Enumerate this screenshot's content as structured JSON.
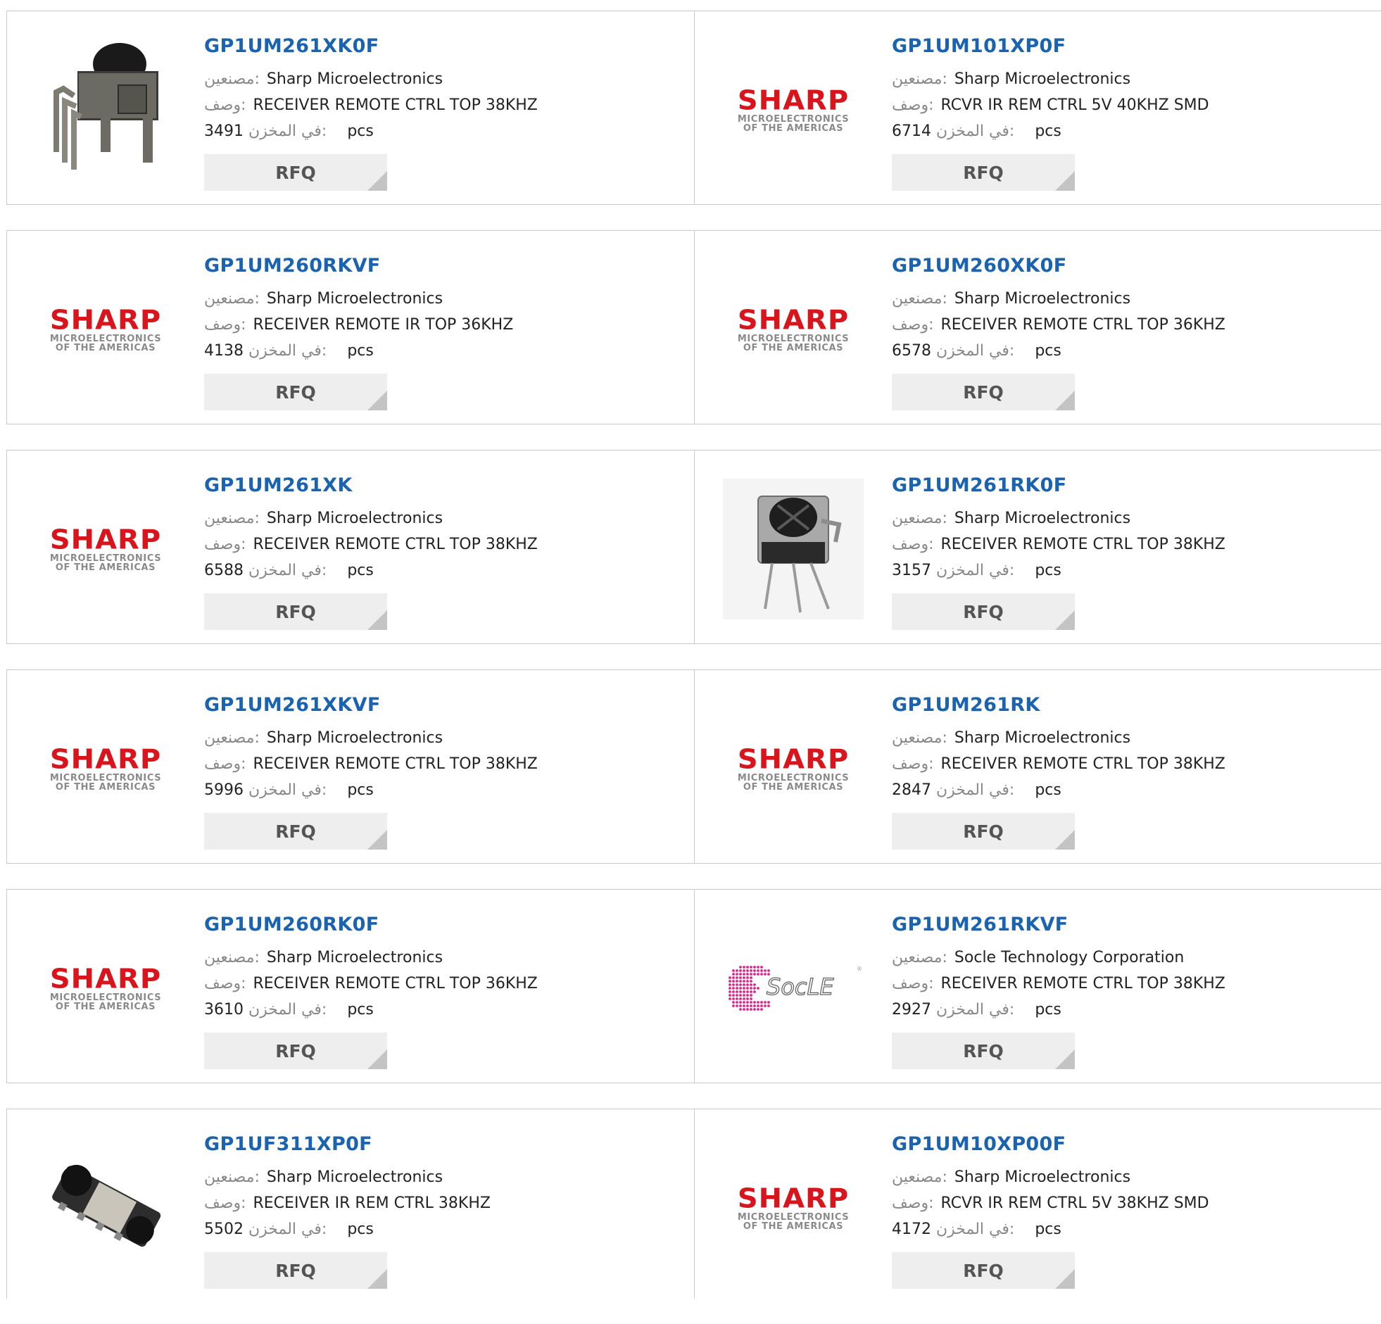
{
  "labels": {
    "manufacturer": "مصنعين:",
    "description": "وصف:",
    "stock": "في المخزن:",
    "unit": "pcs",
    "rfq": "RFQ"
  },
  "logo": {
    "sharp_word": "SHARP",
    "sharp_sub1": "MICROELECTRONICS",
    "sharp_sub2": "OF THE AMERICAS",
    "socle_text": "SocLE"
  },
  "colors": {
    "part_link": "#1a63b0",
    "sharp_red": "#d8141c",
    "socle_pink": "#e0248a",
    "rfq_bg": "#eeeeee",
    "border": "#c9c9c9"
  },
  "products": [
    {
      "part": "GP1UM261XK0F",
      "manufacturer": "Sharp Microelectronics",
      "description": "RECEIVER REMOTE CTRL TOP 38KHZ",
      "stock": "3491",
      "image": "ir-receiver-photo-black"
    },
    {
      "part": "GP1UM101XP0F",
      "manufacturer": "Sharp Microelectronics",
      "description": "RCVR IR REM CTRL 5V 40KHZ SMD",
      "stock": "6714",
      "image": "sharp-logo"
    },
    {
      "part": "GP1UM260RKVF",
      "manufacturer": "Sharp Microelectronics",
      "description": "RECEIVER REMOTE IR TOP 36KHZ",
      "stock": "4138",
      "image": "sharp-logo"
    },
    {
      "part": "GP1UM260XK0F",
      "manufacturer": "Sharp Microelectronics",
      "description": "RECEIVER REMOTE CTRL TOP 36KHZ",
      "stock": "6578",
      "image": "sharp-logo"
    },
    {
      "part": "GP1UM261XK",
      "manufacturer": "Sharp Microelectronics",
      "description": "RECEIVER REMOTE CTRL TOP 38KHZ",
      "stock": "6588",
      "image": "sharp-logo"
    },
    {
      "part": "GP1UM261RK0F",
      "manufacturer": "Sharp Microelectronics",
      "description": "RECEIVER REMOTE CTRL TOP 38KHZ",
      "stock": "3157",
      "image": "ir-receiver-photo-metal"
    },
    {
      "part": "GP1UM261XKVF",
      "manufacturer": "Sharp Microelectronics",
      "description": "RECEIVER REMOTE CTRL TOP 38KHZ",
      "stock": "5996",
      "image": "sharp-logo"
    },
    {
      "part": "GP1UM261RK",
      "manufacturer": "Sharp Microelectronics",
      "description": "RECEIVER REMOTE CTRL TOP 38KHZ",
      "stock": "2847",
      "image": "sharp-logo"
    },
    {
      "part": "GP1UM260RK0F",
      "manufacturer": "Sharp Microelectronics",
      "description": "RECEIVER REMOTE CTRL TOP 36KHZ",
      "stock": "3610",
      "image": "sharp-logo"
    },
    {
      "part": "GP1UM261RKVF",
      "manufacturer": "Socle Technology Corporation",
      "description": "RECEIVER REMOTE CTRL TOP 38KHZ",
      "stock": "2927",
      "image": "socle-logo"
    },
    {
      "part": "GP1UF311XP0F",
      "manufacturer": "Sharp Microelectronics",
      "description": "RECEIVER IR REM CTRL 38KHZ",
      "stock": "5502",
      "image": "smd-receiver-photo"
    },
    {
      "part": "GP1UM10XP00F",
      "manufacturer": "Sharp Microelectronics",
      "description": "RCVR IR REM CTRL 5V 38KHZ SMD",
      "stock": "4172",
      "image": "sharp-logo"
    }
  ]
}
